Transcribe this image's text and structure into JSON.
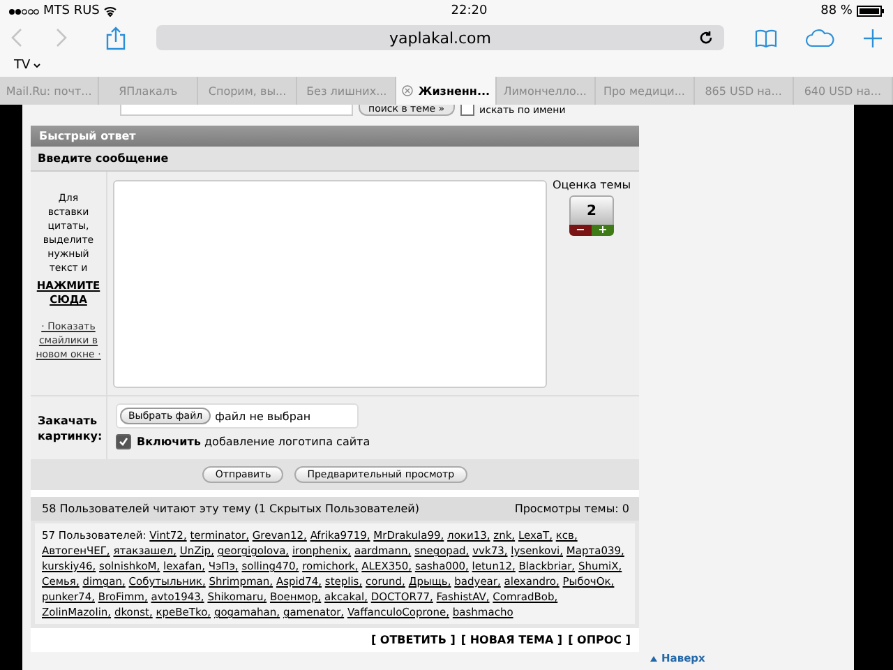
{
  "status_bar": {
    "carrier": "MTS RUS",
    "time": "22:20",
    "battery": "88 %"
  },
  "toolbar": {
    "url": "yaplakal.com",
    "bookmarks_folder": "TV"
  },
  "tabs": [
    {
      "label": "Mail.Ru: почт...",
      "selected": false
    },
    {
      "label": "ЯПлакалъ",
      "selected": false
    },
    {
      "label": "Спорим, вы...",
      "selected": false
    },
    {
      "label": "Без лишних...",
      "selected": false
    },
    {
      "label": "Жизненн...",
      "selected": true
    },
    {
      "label": "Лимончелло...",
      "selected": false
    },
    {
      "label": "Про медици...",
      "selected": false
    },
    {
      "label": "865 USD на...",
      "selected": false
    },
    {
      "label": "640 USD на...",
      "selected": false
    }
  ],
  "search_row": {
    "button": "поиск в теме »",
    "checkbox_label": "искать по имени",
    "checked": false
  },
  "quick_reply": {
    "title": "Быстрый ответ",
    "subtitle": "Введите сообщение",
    "hint": "Для вставки цитаты, выделите нужный текст и",
    "hint_link": "НАЖМИТЕ СЮДА",
    "smilies_link": "· Показать смайлики в новом окне ·",
    "rating_label": "Оценка темы",
    "rating": "2",
    "minus": "−",
    "plus": "+",
    "upload_label": "Закачать картинку:",
    "file_button": "Выбрать файл",
    "file_status": "файл не выбран",
    "logo_option": {
      "label": "**Включить** добавление логотипа сайта",
      "checked": true
    },
    "buttons": [
      "Отправить",
      "Предварительный просмотр"
    ]
  },
  "readers": {
    "summary": "58 Пользователей читают эту тему (1 Скрытых Пользователей)",
    "views": "Просмотры темы: 0",
    "users_label": "57 Пользователей:",
    "users": [
      "Vint72,",
      "terminator,",
      "Grevan12,",
      "Afrika9719,",
      "MrDrakula99,",
      "локи13,",
      "znk,",
      "LexaT,",
      "ксв,",
      "АвтогенЧЕГ,",
      "ятакзашел,",
      "UnZip,",
      "georgigolova,",
      "ironphenix,",
      "aardmann,",
      "snegopad,",
      "vvk73,",
      "lysenkovi,",
      "Марта039,",
      "kurskiy46,",
      "solnishkoM,",
      "lexafan,",
      "ЧэПэ,",
      "solling470,",
      "romichork,",
      "ALEX350,",
      "sasha000,",
      "letun12,",
      "Blackbriar,",
      "ShumiX,",
      "Семья,",
      "dimgan,",
      "Собутыльник,",
      "Shrimpman,",
      "Aspid74,",
      "steplis,",
      "corund,",
      "Дрыщь,",
      "badyear,",
      "alexandro,",
      "РыбочОк,",
      "punker74,",
      "BroFimm,",
      "avto1943,",
      "Shikomaru,",
      "Военмор,",
      "akcakal,",
      "DOCTOR77,",
      "FashistAV,",
      "ComradBob,",
      "ZolinMazolin,",
      "dkonst,",
      "кpeBeTko,",
      "gogamahan,",
      "gamenator,",
      "VaffanculoCoprone,",
      "bashmacho"
    ]
  },
  "actions": [
    "[ ОТВЕТИТЬ ]",
    "[ НОВАЯ ТЕМА ]",
    "[ ОПРОС ]"
  ],
  "top_link": "Наверх"
}
